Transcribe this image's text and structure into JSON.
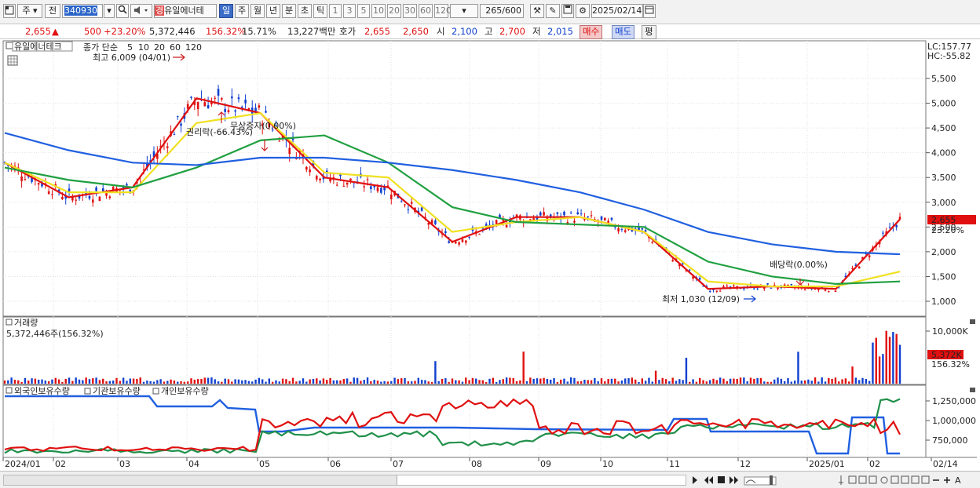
{
  "toolbar": {
    "period_type": "주",
    "market": "전",
    "code": "340930",
    "stock_name": "유일에너테",
    "stock_badge": "경",
    "intervals": [
      "일",
      "주",
      "월",
      "년",
      "분",
      "초",
      "틱"
    ],
    "active_interval": "일",
    "numbers": [
      "1",
      "3",
      "5",
      "10",
      "20",
      "30",
      "60",
      "120"
    ],
    "count": "265",
    "count_total": "/600",
    "date": "2025/02/14"
  },
  "quote": {
    "price": "2,655",
    "arrow": "▲",
    "change": "500",
    "change_pct": "+23.20%",
    "volume": "5,372,446",
    "volume_pct": "156.32%",
    "turnover": "15.71%",
    "amount": "13,227백만",
    "hoga_label": "호가",
    "ask": "2,655",
    "bid": "2,650",
    "open_label": "시",
    "open": "2,100",
    "high_label": "고",
    "high": "2,700",
    "low_label": "저",
    "low": "2,015",
    "buy_label": "매수",
    "sell_label": "매도",
    "avg_label": "평"
  },
  "price_panel": {
    "title": "유일에너테크",
    "ma_label": "종가 단순",
    "ma_periods": [
      "5",
      "10",
      "20",
      "60",
      "120"
    ],
    "ma_colors": [
      "#e01010",
      "#f08a20",
      "#f0e020",
      "#20a040",
      "#2060e0"
    ],
    "lc": "LC:157.77",
    "hc": "HC:-55.82",
    "yticks": [
      "5,500",
      "5,000",
      "4,500",
      "4,000",
      "3,500",
      "3,000",
      "2,500",
      "2,000",
      "1,500",
      "1,000"
    ],
    "current_price_tag": "2,655",
    "current_pct_tag": "23.20%",
    "annotations": {
      "high": "최고 6,009 (04/01)",
      "low": "최저 1,030 (12/09)",
      "rights": "권리락(-66.43%)",
      "bonus": "무상증자(0.00%)",
      "dividend": "배당락(0.00%)"
    }
  },
  "volume_panel": {
    "title": "거래량",
    "info": "5,372,446주(156.32%)",
    "yticks": [
      "10,000K"
    ],
    "tag_value": "5,372K",
    "tag_pct": "156.32%"
  },
  "holding_panel": {
    "legend": [
      "외국인보유수량",
      "기관보유수량",
      "개인보유수량"
    ],
    "yticks": [
      "1,250,000",
      "1,000,000",
      "750,000"
    ]
  },
  "x_axis": {
    "labels": [
      "2024/01",
      "02",
      "03",
      "04",
      "05",
      "06",
      "07",
      "08",
      "09",
      "10",
      "11",
      "12",
      "2025/01",
      "02",
      "02/14"
    ]
  },
  "chart_data": {
    "type": "line",
    "title": "유일에너테크",
    "xlabel": "",
    "ylabel": "",
    "x": [
      "2024/01",
      "02",
      "03",
      "04",
      "05",
      "06",
      "07",
      "08",
      "09",
      "10",
      "11",
      "12",
      "2025/01",
      "02",
      "02/14"
    ],
    "ylim": [
      1000,
      6009
    ],
    "series": [
      {
        "name": "5",
        "values": [
          3800,
          3100,
          3300,
          5100,
          4800,
          3500,
          3300,
          2200,
          2700,
          2700,
          2400,
          1250,
          1300,
          1250,
          2655
        ]
      },
      {
        "name": "20",
        "values": [
          3800,
          3200,
          3200,
          4600,
          4800,
          3600,
          3500,
          2400,
          2600,
          2700,
          2400,
          1400,
          1300,
          1300,
          1600
        ]
      },
      {
        "name": "60",
        "values": [
          3700,
          3450,
          3300,
          3700,
          4250,
          4350,
          3800,
          2900,
          2600,
          2550,
          2500,
          1800,
          1500,
          1350,
          1400
        ]
      },
      {
        "name": "120",
        "values": [
          4400,
          4050,
          3800,
          3750,
          3900,
          3900,
          3800,
          3650,
          3450,
          3200,
          2850,
          2400,
          2150,
          2000,
          1950
        ]
      }
    ],
    "high": 6009,
    "low": 1030
  }
}
